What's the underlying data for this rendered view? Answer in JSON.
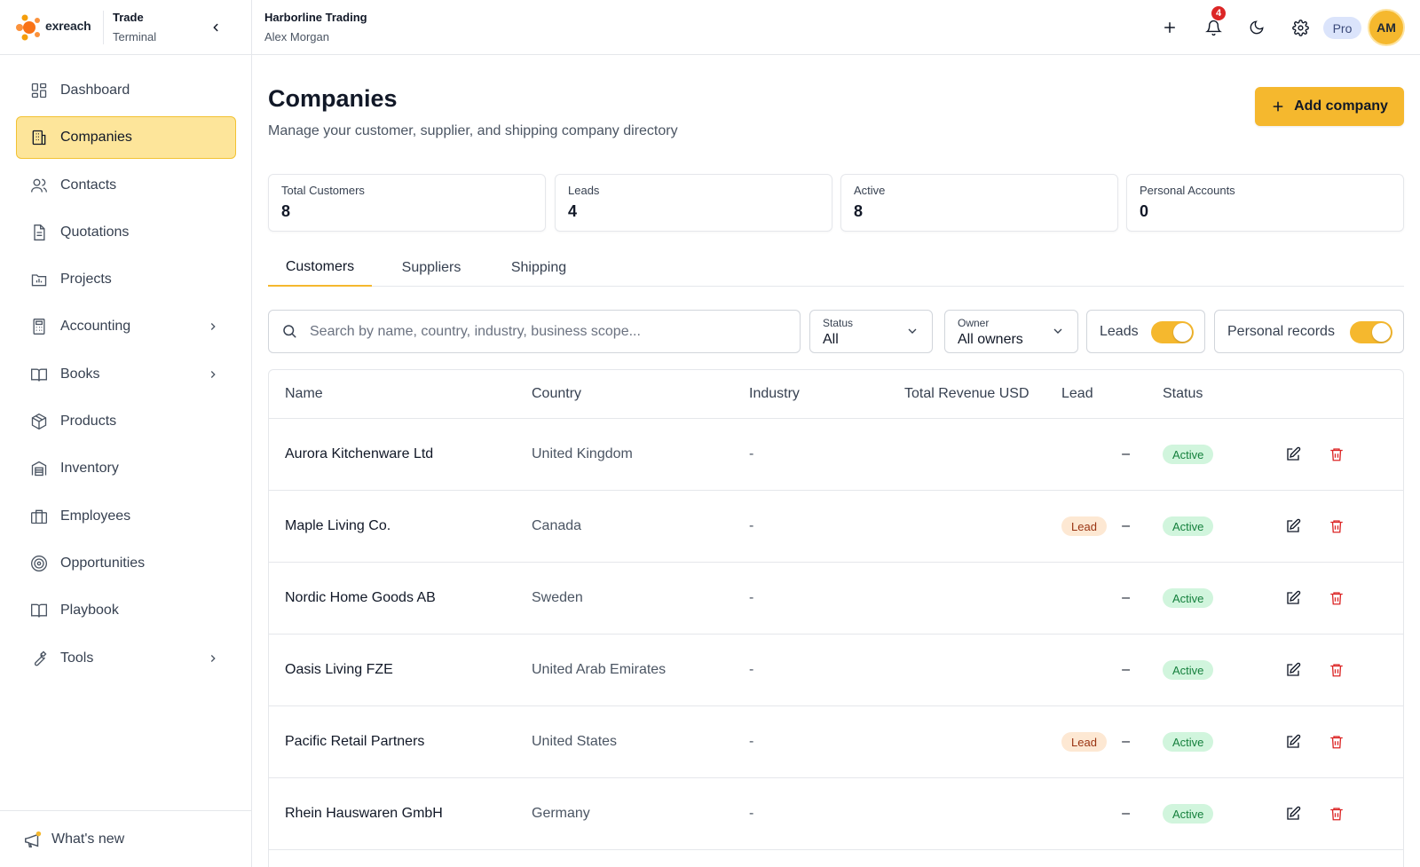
{
  "brand": {
    "logo_text": "exreach",
    "name": "Trade",
    "sub": "Terminal"
  },
  "header": {
    "org_name": "Harborline Trading",
    "user_name": "Alex Morgan",
    "notif_count": "4",
    "plan": "Pro",
    "avatar_initials": "AM"
  },
  "sidebar": {
    "items": [
      {
        "label": "Dashboard",
        "icon": "dashboard-icon"
      },
      {
        "label": "Companies",
        "icon": "building-icon",
        "active": true
      },
      {
        "label": "Contacts",
        "icon": "users-icon"
      },
      {
        "label": "Quotations",
        "icon": "document-icon"
      },
      {
        "label": "Projects",
        "icon": "folder-icon"
      },
      {
        "label": "Accounting",
        "icon": "calculator-icon",
        "has_children": true
      },
      {
        "label": "Books",
        "icon": "book-icon",
        "has_children": true
      },
      {
        "label": "Products",
        "icon": "package-icon"
      },
      {
        "label": "Inventory",
        "icon": "warehouse-icon"
      },
      {
        "label": "Employees",
        "icon": "briefcase-icon"
      },
      {
        "label": "Opportunities",
        "icon": "target-icon"
      },
      {
        "label": "Playbook",
        "icon": "book-open-icon"
      },
      {
        "label": "Tools",
        "icon": "wrench-icon",
        "has_children": true
      }
    ],
    "whats_new": "What's new"
  },
  "page": {
    "title": "Companies",
    "subtitle": "Manage your customer, supplier, and shipping company directory",
    "add_button": "Add company"
  },
  "stats": [
    {
      "label": "Total Customers",
      "value": "8"
    },
    {
      "label": "Leads",
      "value": "4"
    },
    {
      "label": "Active",
      "value": "8"
    },
    {
      "label": "Personal Accounts",
      "value": "0"
    }
  ],
  "tabs": [
    {
      "label": "Customers",
      "active": true
    },
    {
      "label": "Suppliers"
    },
    {
      "label": "Shipping"
    }
  ],
  "filters": {
    "search_placeholder": "Search by name, country, industry, business scope...",
    "search_value": "",
    "status": {
      "caption": "Status",
      "value": "All"
    },
    "owner": {
      "caption": "Owner",
      "value": "All owners"
    },
    "leads_toggle": {
      "label": "Leads",
      "on": true
    },
    "personal_toggle": {
      "label": "Personal records",
      "on": true
    }
  },
  "table": {
    "columns": [
      "Name",
      "Country",
      "Industry",
      "Total Revenue USD",
      "Lead",
      "Status"
    ],
    "rows": [
      {
        "name": "Aurora Kitchenware Ltd",
        "country": "United Kingdom",
        "industry": "-",
        "revenue": "–",
        "lead": "",
        "status": "Active"
      },
      {
        "name": "Maple Living Co.",
        "country": "Canada",
        "industry": "-",
        "revenue": "–",
        "lead": "Lead",
        "status": "Active"
      },
      {
        "name": "Nordic Home Goods AB",
        "country": "Sweden",
        "industry": "-",
        "revenue": "–",
        "lead": "",
        "status": "Active"
      },
      {
        "name": "Oasis Living FZE",
        "country": "United Arab Emirates",
        "industry": "-",
        "revenue": "–",
        "lead": "",
        "status": "Active"
      },
      {
        "name": "Pacific Retail Partners",
        "country": "United States",
        "industry": "-",
        "revenue": "–",
        "lead": "Lead",
        "status": "Active"
      },
      {
        "name": "Rhein Hauswaren GmbH",
        "country": "Germany",
        "industry": "-",
        "revenue": "–",
        "lead": "",
        "status": "Active"
      }
    ]
  },
  "colors": {
    "accent": "#f5b82e",
    "active_nav_bg": "#fde59a",
    "status_green": "#15803d",
    "lead_orange": "#9a3412",
    "danger": "#dc2626"
  }
}
